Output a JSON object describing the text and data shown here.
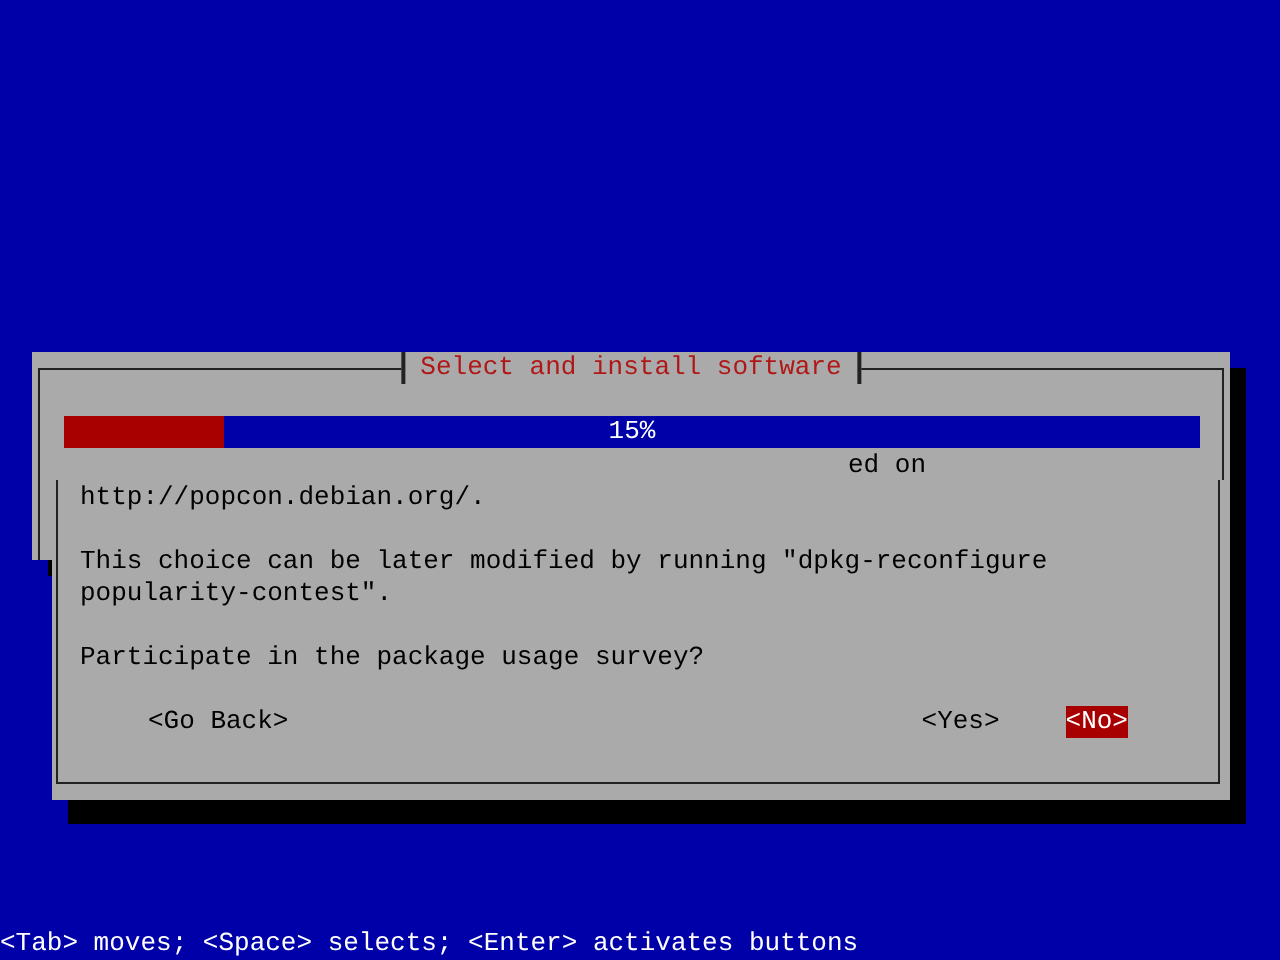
{
  "progress_window": {
    "title": "Select and install software",
    "progress": {
      "level": 0.14,
      "label": "15%"
    },
    "partial_text": "ed on"
  },
  "dialog": {
    "paragraphs": [
      [
        "http://popcon.debian.org/."
      ],
      [
        "This choice can be later modified by running \"dpkg-reconfigure",
        "popularity-contest\"."
      ],
      [
        "Participate in the package usage survey?"
      ]
    ],
    "buttons": [
      {
        "label": "<Go Back>",
        "selected": false
      },
      {
        "label": "<Yes>",
        "selected": false
      },
      {
        "label": "<No>",
        "selected": true
      }
    ]
  },
  "status_bar": "<Tab> moves; <Space> selects; <Enter> activates buttons"
}
